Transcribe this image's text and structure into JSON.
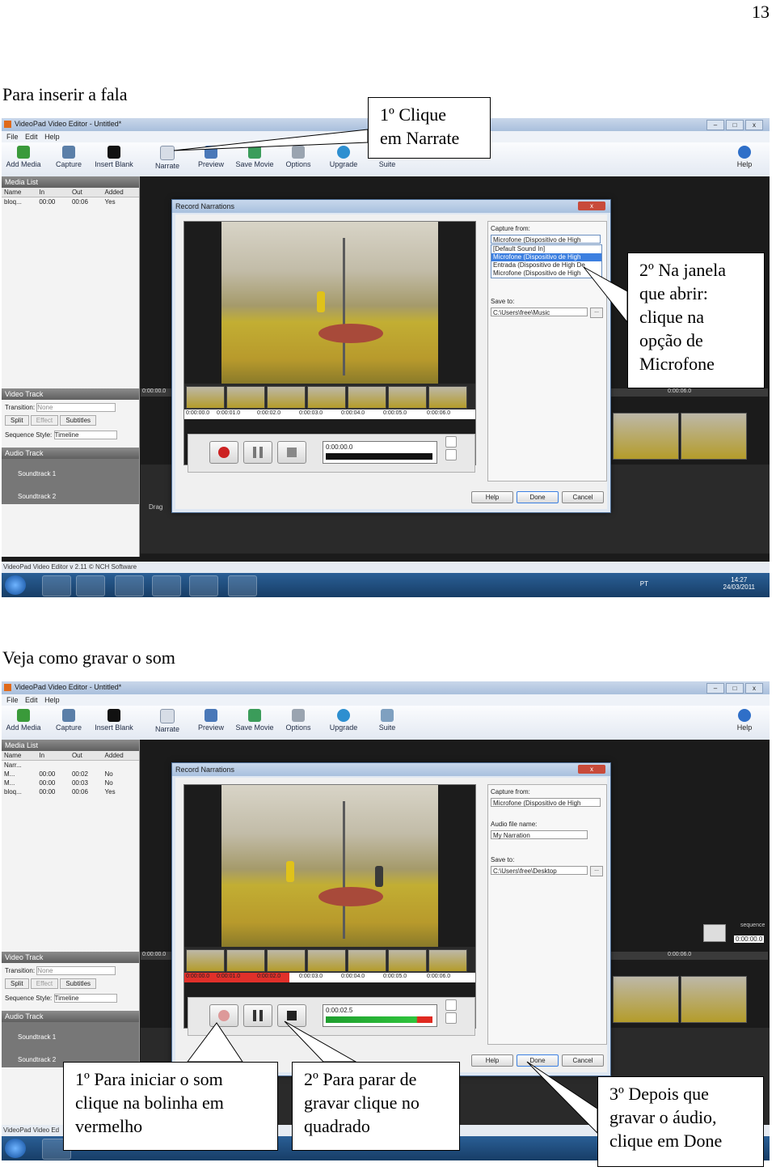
{
  "page_number": "13",
  "section1": {
    "heading": "Para inserir a fala",
    "callout1": [
      "1º Clique",
      "em Narrate"
    ],
    "callout2": [
      "2º Na janela",
      "que abrir:",
      "clique na",
      "opção de",
      "Microfone"
    ]
  },
  "section2": {
    "heading": "Veja como gravar o som",
    "callout1": [
      "1º Para iniciar o som",
      "clique na bolinha em",
      "vermelho"
    ],
    "callout2": [
      "2º Para parar de",
      "gravar clique no",
      "quadrado"
    ],
    "callout3": [
      "3º Depois que",
      "gravar o áudio,",
      "clique em Done"
    ]
  },
  "app": {
    "title": "VideoPad Video Editor - Untitled*",
    "menu": [
      "File",
      "Edit",
      "Help"
    ],
    "toolbar": [
      "Add Media",
      "Capture",
      "Insert Blank",
      "Narrate",
      "Preview",
      "Save Movie",
      "Options",
      "Upgrade",
      "Suite"
    ],
    "help": "Help",
    "media_list_title": "Media List",
    "media_columns": [
      "Name",
      "In",
      "Out",
      "Added"
    ],
    "media_rows_1": [
      [
        "bloq...",
        "00:00",
        "00:06",
        "Yes"
      ]
    ],
    "media_rows_2": [
      [
        "Narr...",
        "",
        "",
        ""
      ],
      [
        "M...",
        "00:00",
        "00:02",
        "No"
      ],
      [
        "M...",
        "00:00",
        "00:03",
        "No"
      ],
      [
        "bloq...",
        "00:00",
        "00:06",
        "Yes"
      ]
    ],
    "video_track": "Video Track",
    "transition_label": "Transition:",
    "transition_value": "None",
    "split": "Split",
    "effect": "Effect",
    "subtitles": "Subtitles",
    "sequence_style_label": "Sequence Style:",
    "sequence_style_value": "Timeline",
    "audio_track": "Audio Track",
    "soundtrack1": "Soundtrack 1",
    "soundtrack2": "Soundtrack 2",
    "drag_hint": "Drag",
    "status": "VideoPad Video Editor v 2.11 © NCH Software",
    "status_short": "VideoPad Video Ed",
    "timeline_start": "0:00:00.0",
    "timeline_mid": "0:00:06.0",
    "sequence_label": "sequence",
    "sequence_time": "0:00:00.0"
  },
  "dialog": {
    "title": "Record Narrations",
    "capture_from_label": "Capture from:",
    "capture_from_value": "Microfone (Dispositivo de High",
    "dropdown_options": [
      "[Default Sound In]",
      "Microfone (Dispositivo de High",
      "Entrada (Dispositivo de High De",
      "Microfone (Dispositivo de High"
    ],
    "audio_file_label": "Audio file name:",
    "audio_file_value": "My Narration",
    "save_to_label": "Save to:",
    "save_to_value_1": "C:\\Users\\free\\Music",
    "save_to_value_2": "C:\\Users\\free\\Desktop",
    "time_1": "0:00:00.0",
    "time_2": "0:00:02.5",
    "ruler": [
      "0:00:00.0",
      "0:00:01.0",
      "0:00:02.0",
      "0:00:03.0",
      "0:00:04.0",
      "0:00:05.0",
      "0:00:06.0"
    ],
    "help": "Help",
    "done": "Done",
    "cancel": "Cancel"
  },
  "taskbar": {
    "lang": "PT",
    "time": "14:27",
    "date": "24/03/2011"
  }
}
